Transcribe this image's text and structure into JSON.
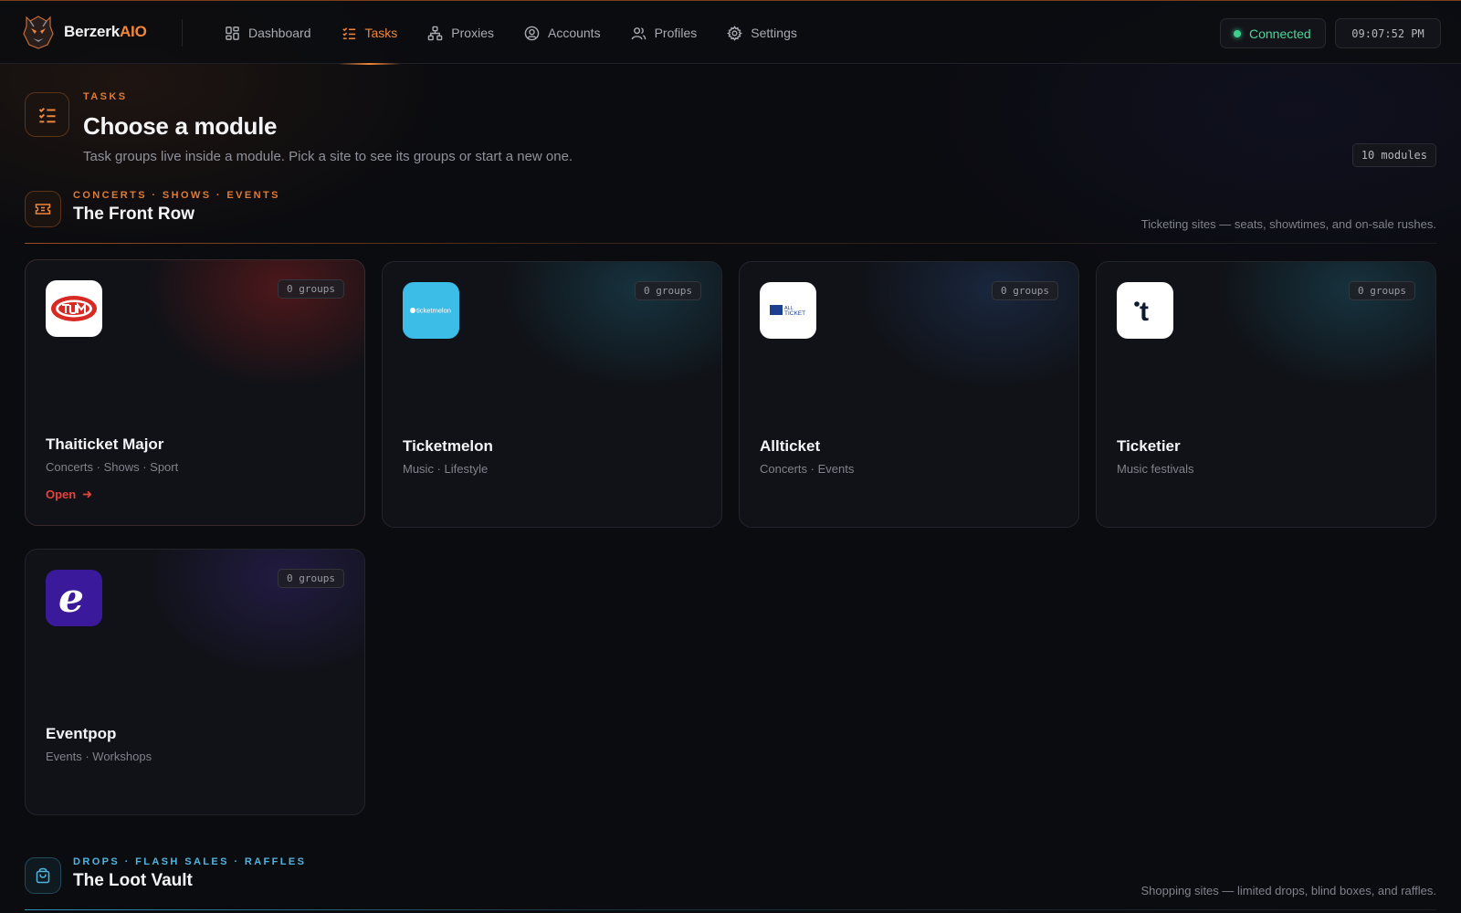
{
  "app": {
    "brand_primary": "Berzerk",
    "brand_accent": "AIO",
    "accent_color": "#f0873a"
  },
  "nav": {
    "items": [
      {
        "label": "Dashboard",
        "icon": "dashboard-icon"
      },
      {
        "label": "Tasks",
        "icon": "tasks-icon",
        "active": true
      },
      {
        "label": "Proxies",
        "icon": "proxies-icon"
      },
      {
        "label": "Accounts",
        "icon": "accounts-icon"
      },
      {
        "label": "Profiles",
        "icon": "profiles-icon"
      },
      {
        "label": "Settings",
        "icon": "settings-icon"
      }
    ]
  },
  "status": {
    "label": "Connected",
    "color": "#3ecf8e",
    "clock": "09:07:52 PM"
  },
  "header": {
    "eyebrow": "TASKS",
    "title": "Choose a module",
    "subtitle": "Task groups live inside a module. Pick a site to see its groups or start a new one.",
    "module_count": "10 modules"
  },
  "sections": [
    {
      "eyebrow": "CONCERTS · SHOWS · EVENTS",
      "title": "The Front Row",
      "description": "Ticketing sites — seats, showtimes, and on-sale rushes.",
      "icon": "ticket-icon",
      "modules": [
        {
          "name": "Thaiticket Major",
          "tags": "Concerts · Shows · Sport",
          "groups": "0 groups",
          "open_label": "Open",
          "logo": "thaiticket-logo"
        },
        {
          "name": "Ticketmelon",
          "tags": "Music · Lifestyle",
          "groups": "0 groups",
          "logo": "ticketmelon-logo",
          "logo_text": "ticketmelon"
        },
        {
          "name": "Allticket",
          "tags": "Concerts · Events",
          "groups": "0 groups",
          "logo": "allticket-logo",
          "logo_text_top": "ALL",
          "logo_text_bottom": "TICKET"
        },
        {
          "name": "Ticketier",
          "tags": "Music festivals",
          "groups": "0 groups",
          "logo": "ticketier-logo",
          "logo_text": "t"
        },
        {
          "name": "Eventpop",
          "tags": "Events · Workshops",
          "groups": "0 groups",
          "logo": "eventpop-logo",
          "logo_text": "e"
        }
      ]
    },
    {
      "eyebrow": "DROPS · FLASH SALES · RAFFLES",
      "title": "The Loot Vault",
      "description": "Shopping sites — limited drops, blind boxes, and raffles.",
      "icon": "shopping-bag-icon"
    }
  ]
}
